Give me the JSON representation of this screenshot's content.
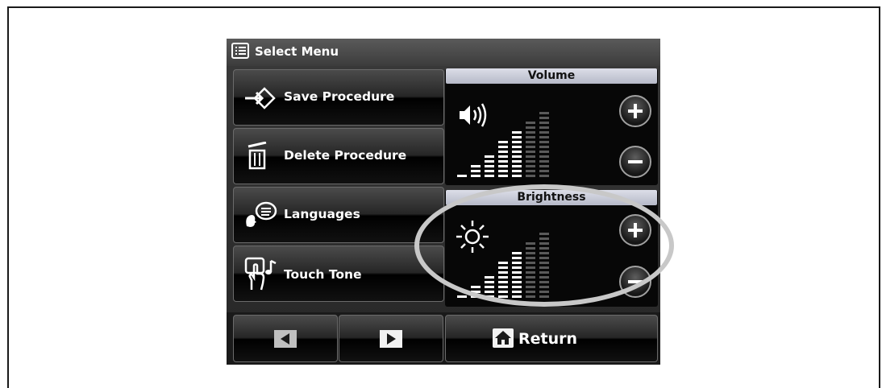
{
  "header": {
    "title": "Select Menu",
    "icon": "list-menu-icon"
  },
  "menu": {
    "save": "Save Procedure",
    "delete": "Delete Procedure",
    "languages": "Languages",
    "touch_tone": "Touch Tone"
  },
  "volume": {
    "label": "Volume",
    "level": 5,
    "max_level": 7,
    "icon": "speaker-icon"
  },
  "brightness": {
    "label": "Brightness",
    "level": 5,
    "max_level": 7,
    "icon": "sun-icon"
  },
  "nav": {
    "return_label": "Return",
    "prev_icon": "arrow-left-icon",
    "next_icon": "arrow-right-icon"
  },
  "colors": {
    "panel_header": "#c8cad6",
    "highlight_ellipse": "#c8c8c8"
  }
}
